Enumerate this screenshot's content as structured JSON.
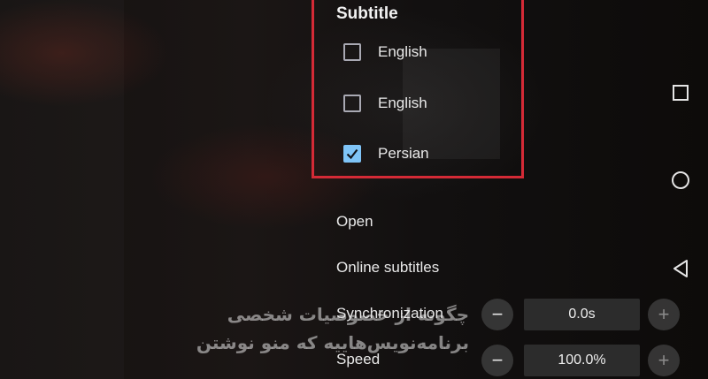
{
  "subtitle_panel": {
    "title": "Subtitle",
    "tracks": [
      {
        "label": "English",
        "checked": false
      },
      {
        "label": "English",
        "checked": false
      },
      {
        "label": "Persian",
        "checked": true
      }
    ],
    "highlight_color": "#d42a36",
    "check_color": "#7fc4f7"
  },
  "menu": {
    "open_label": "Open",
    "online_label": "Online subtitles"
  },
  "synchronization": {
    "label": "Synchronization",
    "value": "0.0s",
    "minus": "−",
    "plus": "+"
  },
  "speed": {
    "label": "Speed",
    "value": "100.0%",
    "minus": "−",
    "plus": "+"
  },
  "video_subtitle": {
    "line1": "چگونه از خصوصیات شخصی",
    "line2": "برنامه‌نویس‌هاییه که منو نوشتن"
  },
  "nav": {
    "recents": "square-icon",
    "home": "circle-icon",
    "back": "triangle-back-icon"
  }
}
